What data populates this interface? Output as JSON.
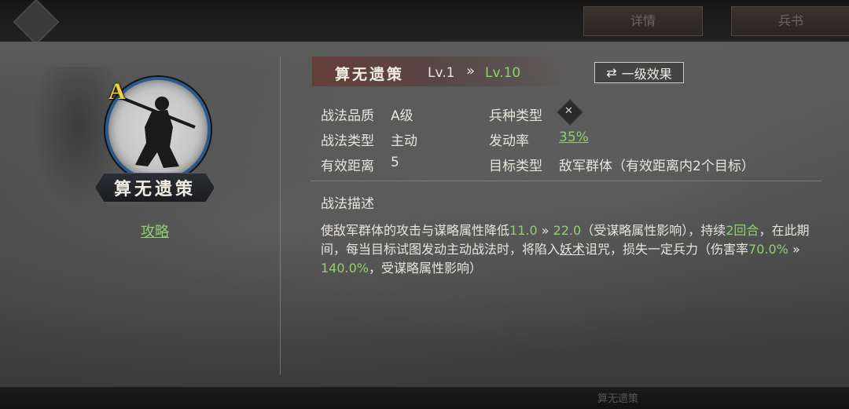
{
  "topbar": {
    "btn1_label": "详情",
    "btn2_label": "兵书"
  },
  "skill": {
    "grade": "A",
    "name": "算无遗策",
    "strategy_link": "攻略",
    "level_from": "Lv.1",
    "level_arrow": "»",
    "level_to": "Lv.10",
    "effect_button": "一级效果"
  },
  "attributes": {
    "quality_label": "战法品质",
    "quality_value": "A级",
    "type_label": "战法类型",
    "type_value": "主动",
    "range_label": "有效距离",
    "range_value": "5",
    "troop_label": "兵种类型",
    "rate_label": "发动率",
    "rate_value": "35%",
    "target_label": "目标类型",
    "target_value": "敌军群体（有效距离内2个目标）"
  },
  "description": {
    "title": "战法描述",
    "p1": "使敌军群体的攻击与谋略属性降低",
    "v1": "11.0",
    "a1": " » ",
    "v2": "22.0",
    "p2": "（受谋略属性影响），持续",
    "v3": "2回合",
    "p3": "，在此期间，每当目标试图发动主动战法时，将陷入",
    "p4": "妖术",
    "p5": "诅咒，损失一定兵力（伤害率",
    "v4": "70.0%",
    "a2": " » ",
    "v5": "140.0%",
    "p6": "，受谋略属性影响）"
  },
  "bottombar": {
    "text": "算无遗策"
  },
  "colors": {
    "accent_green": "#8fd06c",
    "grade_gold": "#f3d040",
    "ring_blue": "#2c5a8a"
  }
}
